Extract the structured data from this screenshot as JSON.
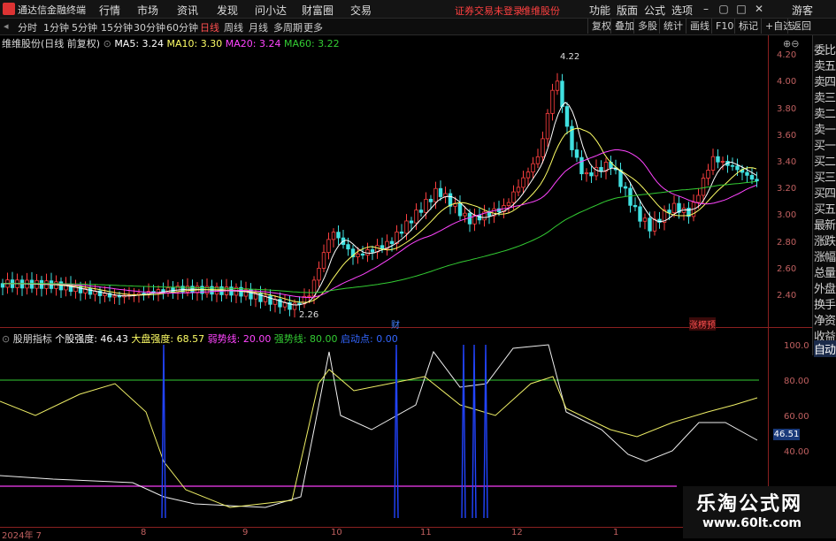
{
  "menubar": {
    "app_title": "通达信金融终端",
    "items": [
      "行情",
      "市场",
      "资讯",
      "发现",
      "问小达",
      "财富圈",
      "交易"
    ],
    "warning": "证券交易未登录",
    "warning2": "维维股份",
    "right_items": [
      "功能",
      "版面",
      "公式",
      "选项"
    ],
    "guest": "游客"
  },
  "periodbar": {
    "items": [
      "分时",
      "1分钟",
      "5分钟",
      "15分钟",
      "30分钟",
      "60分钟",
      "日线",
      "周线",
      "月线",
      "多周期",
      "更多"
    ],
    "selected": "日线"
  },
  "toolbar": {
    "items": [
      "复权",
      "叠加",
      "多股",
      "统计",
      "画线",
      "F10",
      "标记",
      "+自选",
      "返回"
    ]
  },
  "sidebar": {
    "items": [
      "委比",
      "卖五",
      "卖四",
      "卖三",
      "卖二",
      "卖一",
      "买一",
      "买二",
      "买三",
      "买四",
      "买五",
      "最新",
      "涨跌",
      "涨幅",
      "总量",
      "外盘",
      "换手",
      "净资",
      "收益",
      "自动"
    ]
  },
  "main_chart": {
    "title": "维维股份(日线 前复权)",
    "ma5_label": "MA5: 3.24",
    "ma10_label": "MA10: 3.30",
    "ma20_label": "MA20: 3.24",
    "ma60_label": "MA60: 3.22",
    "colors": {
      "ma5": "#ffffff",
      "ma10": "#ffff66",
      "ma20": "#ff44ff",
      "ma60": "#33cc33",
      "up": "#ff4040",
      "down": "#40e0e0"
    },
    "y_ticks": [
      "4.20",
      "4.00",
      "3.80",
      "3.60",
      "3.40",
      "3.20",
      "3.00",
      "2.80",
      "2.60",
      "2.40"
    ],
    "high_label": "4.22",
    "low_label": "2.26",
    "mark_cai": "财",
    "mark_zt": "涨楞预"
  },
  "indicator": {
    "name": "股朋指标",
    "v1": "个股强度: 46.43",
    "v2": "大盘强度: 68.57",
    "v3": "弱势线: 20.00",
    "v4": "强势线: 80.00",
    "v5": "启动点: 0.00",
    "y_ticks": [
      "100.0",
      "80.00",
      "60.00",
      "40.00"
    ],
    "last_value": "46.51"
  },
  "dates": [
    "2024年 7",
    "8",
    "9",
    "10",
    "11",
    "12",
    "1"
  ],
  "watermark": {
    "line1": "乐淘公式网",
    "line2": "www.60lt.com"
  }
}
